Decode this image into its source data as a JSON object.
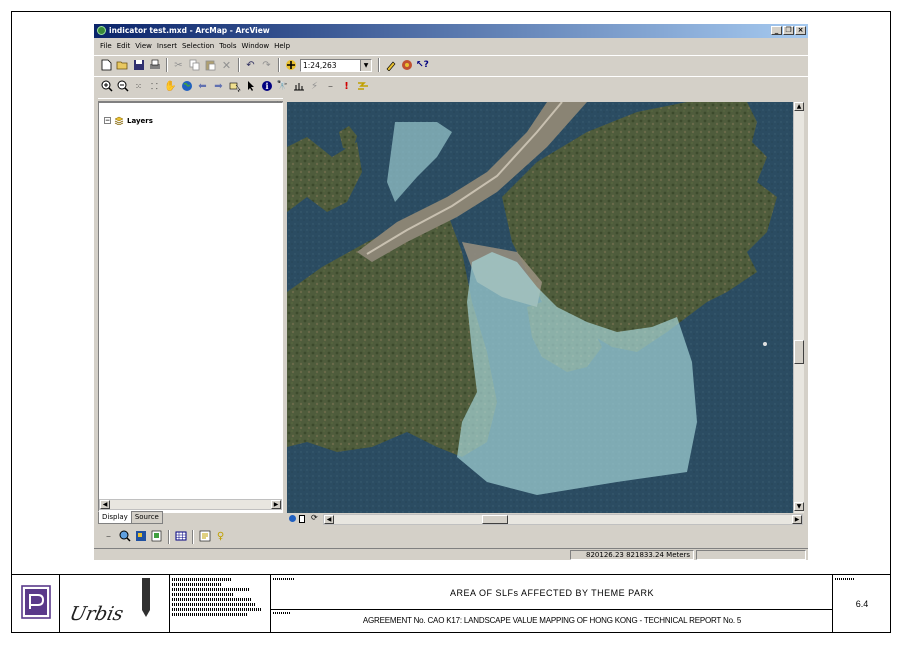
{
  "window": {
    "title": "indicator test.mxd - ArcMap - ArcView",
    "buttons": [
      "_",
      "❐",
      "×"
    ]
  },
  "menu": [
    "File",
    "Edit",
    "View",
    "Insert",
    "Selection",
    "Tools",
    "Window",
    "Help"
  ],
  "toolbar": {
    "scale_value": "1:24,263"
  },
  "toc": {
    "root_label": "Layers",
    "expander": "⊟",
    "tabs": [
      "Display",
      "Source"
    ]
  },
  "status": {
    "coordinates": "820126.23  821833.24 Meters"
  },
  "titleblock": {
    "drawing_title": "AREA OF SLFs AFFECTED BY THEME PARK",
    "report_title": "AGREEMENT No. CAO K17: LANDSCAPE VALUE MAPPING OF HONG KONG - TECHNICAL REPORT No. 5",
    "figure_number": "6.4",
    "logo_text": "Urbis"
  },
  "colors": {
    "titlebar_start": "#0a246a",
    "titlebar_end": "#a6caf0",
    "chrome": "#d4d0c8",
    "sea": "#2a4a60",
    "land": "#4a5a3a",
    "slf_overlay": "#a8d8dc"
  }
}
